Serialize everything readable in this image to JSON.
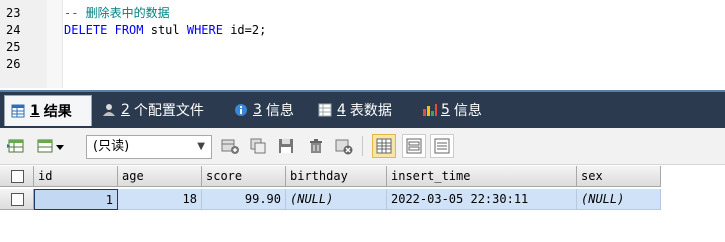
{
  "editor": {
    "lines": [
      {
        "num": "23",
        "tokens": [
          {
            "t": "-- 删除表中的数据",
            "c": "cmt"
          }
        ]
      },
      {
        "num": "24",
        "tokens": [
          {
            "t": "DELETE",
            "c": "kw"
          },
          {
            "t": " ",
            "c": "tx"
          },
          {
            "t": "FROM",
            "c": "kw"
          },
          {
            "t": " stul ",
            "c": "tx"
          },
          {
            "t": "WHERE",
            "c": "kw"
          },
          {
            "t": " id=2;",
            "c": "tx"
          }
        ]
      },
      {
        "num": "25",
        "tokens": []
      },
      {
        "num": "26",
        "tokens": []
      }
    ]
  },
  "tabs": [
    {
      "num": "1",
      "label": "结果",
      "icon": "result-grid-icon",
      "active": true
    },
    {
      "num": "2",
      "label": "个配置文件",
      "icon": "profile-icon",
      "active": false
    },
    {
      "num": "3",
      "label": "信息",
      "icon": "info-icon",
      "active": false
    },
    {
      "num": "4",
      "label": "表数据",
      "icon": "table-data-icon",
      "active": false
    },
    {
      "num": "5",
      "label": "信息",
      "icon": "messages-icon",
      "active": false
    }
  ],
  "toolbar": {
    "mode_value": "(只读)",
    "icons": [
      "export-grid-icon",
      "filter-dropdown-icon",
      "add-row-icon",
      "duplicate-row-icon",
      "save-icon",
      "delete-icon",
      "cancel-icon",
      "grid-view-icon",
      "form-view-icon",
      "text-view-icon"
    ]
  },
  "grid": {
    "columns": [
      "id",
      "age",
      "score",
      "birthday",
      "insert_time",
      "sex"
    ],
    "rows": [
      [
        "1",
        "18",
        "99.90",
        "(NULL)",
        "2022-03-05 22:30:11",
        "(NULL)"
      ]
    ]
  },
  "colors": {
    "tabbar_bg": "#2b3a4f",
    "selected_row": "#cfe2f7",
    "keyword": "#0000ff",
    "comment": "#008080"
  }
}
